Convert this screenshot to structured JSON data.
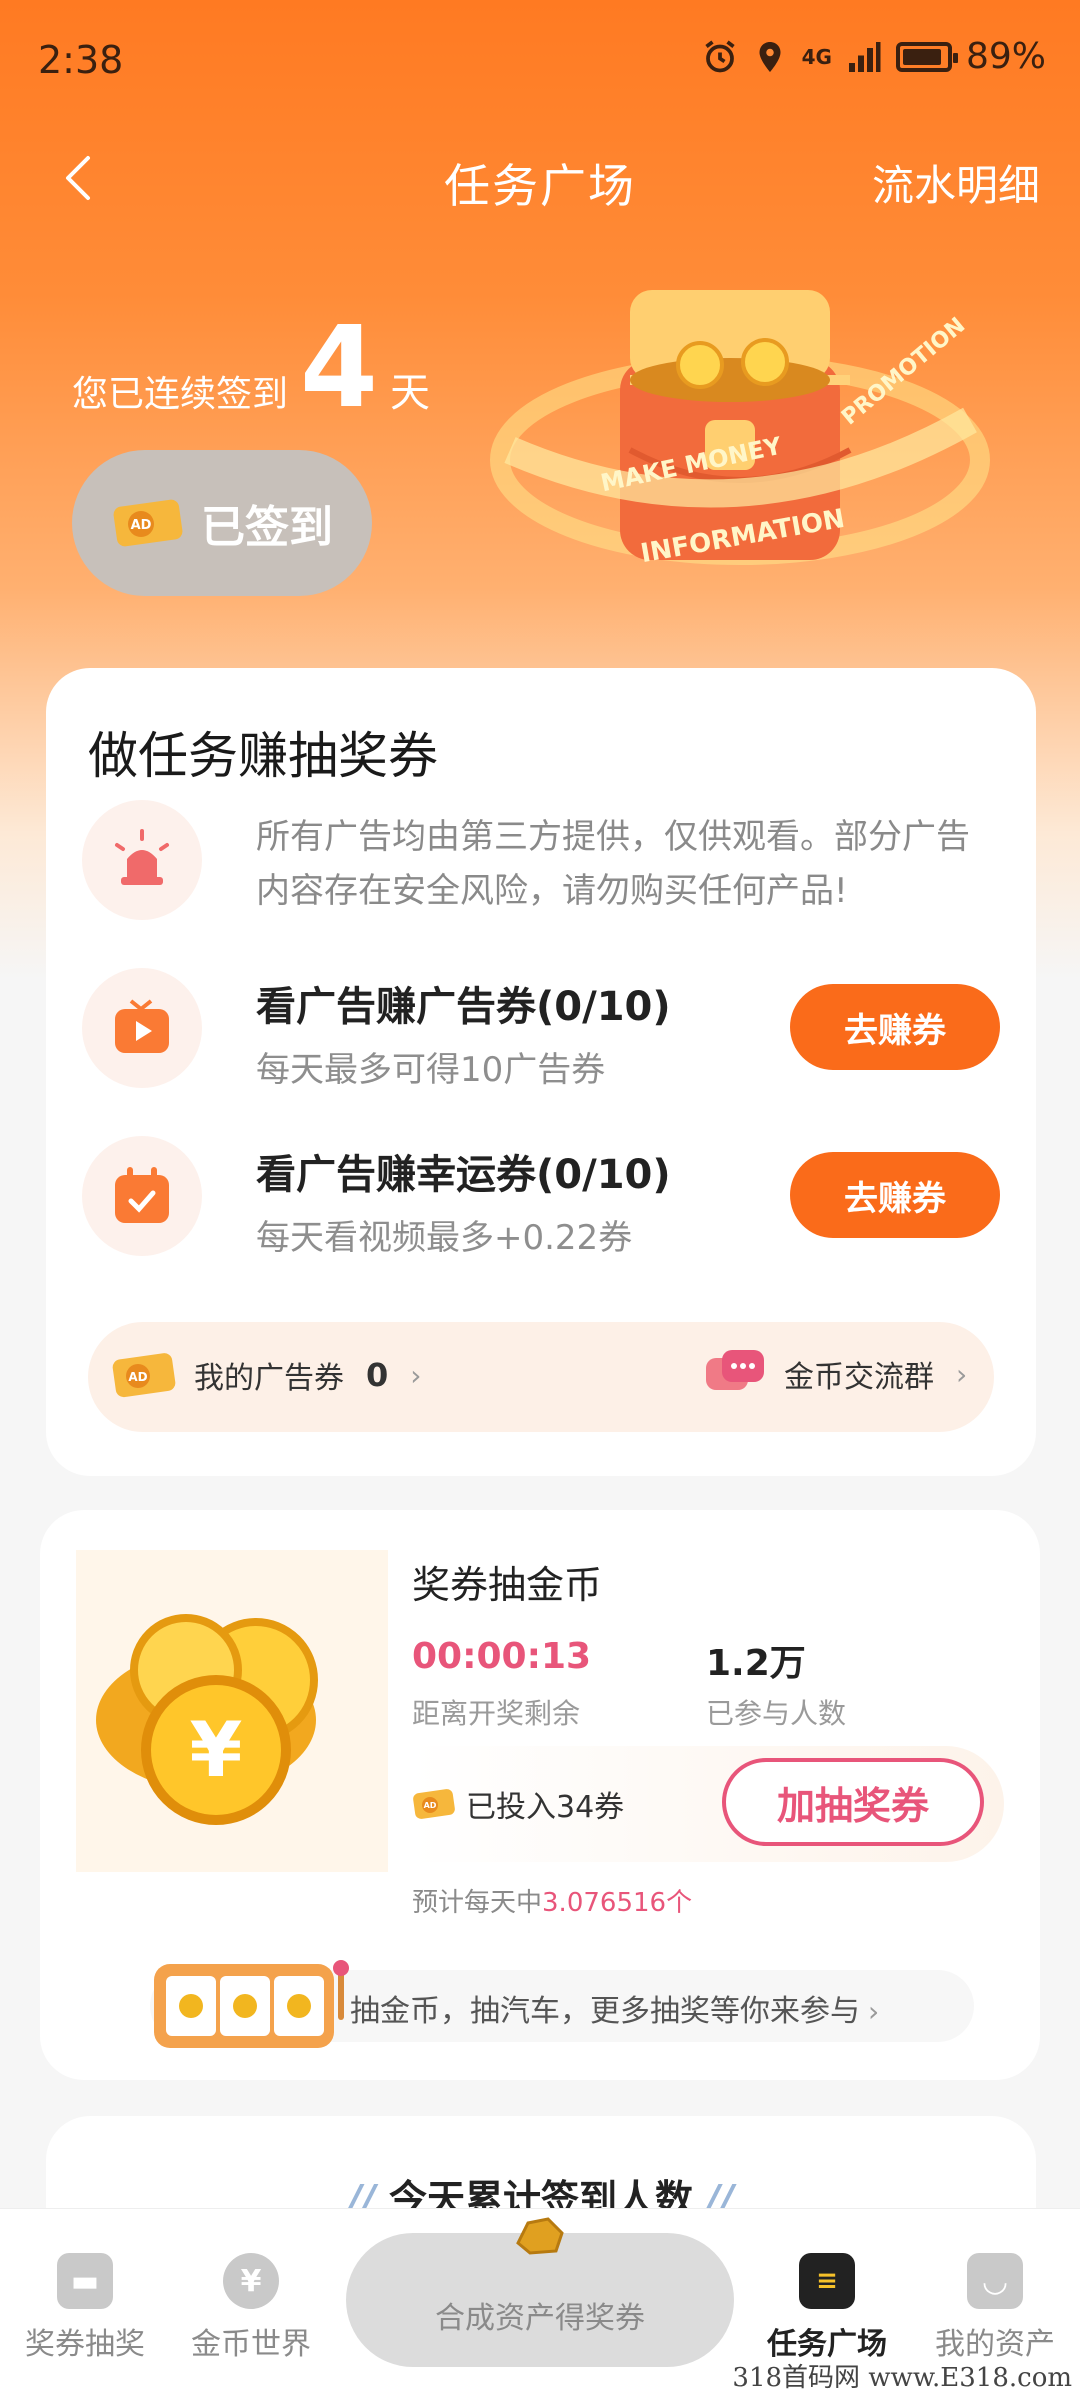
{
  "status_bar": {
    "time": "2:38",
    "network": "4G",
    "battery": "89%"
  },
  "nav": {
    "title": "任务广场",
    "right_link": "流水明细"
  },
  "checkin": {
    "prefix": "您已连续签到",
    "days": "4",
    "suffix": "天",
    "button": "已签到"
  },
  "hero_art": {
    "ticket_text": "AD",
    "ribbon_1": "MAKE MONEY",
    "ribbon_2": "INFORMATION",
    "ribbon_3": "PROMOTION"
  },
  "task_card": {
    "title": "做任务赚抽奖券",
    "notice": "所有广告均由第三方提供，仅供观看。部分广告内容存在安全风险，请勿购买任何产品!",
    "tasks": [
      {
        "name": "看广告赚广告券(0/10)",
        "sub": "每天最多可得10广告券",
        "button": "去赚券"
      },
      {
        "name": "看广告赚幸运券(0/10)",
        "sub": "每天看视频最多+0.22券",
        "button": "去赚券"
      }
    ],
    "my_coupon_label": "我的广告券",
    "my_coupon_count": "0",
    "group_label": "金币交流群"
  },
  "lottery": {
    "title": "奖券抽金币",
    "countdown": "00:00:13",
    "countdown_label": "距离开奖剩余",
    "participants": "1.2万",
    "participants_label": "已参与人数",
    "invested": "已投入34券",
    "add_button": "加抽奖券",
    "daily_prefix": "预计每天中",
    "daily_value": "3.076516个",
    "promo": "抽金币，抽汽车，更多抽奖等你来参与"
  },
  "signin": {
    "title": "今天累计签到人数"
  },
  "bottom_nav": {
    "tabs": [
      {
        "label": "奖券抽奖",
        "icon": "gift-icon"
      },
      {
        "label": "金币世界",
        "icon": "yen-coin-icon"
      },
      {
        "label": "合成资产得奖券",
        "icon": "gold-nugget-icon"
      },
      {
        "label": "任务广场",
        "icon": "clipboard-icon"
      },
      {
        "label": "我的资产",
        "icon": "wallet-icon"
      }
    ]
  },
  "watermark": "318首码网 www.E318.com",
  "colors": {
    "accent": "#fa6b1a",
    "pink": "#e8557a"
  }
}
